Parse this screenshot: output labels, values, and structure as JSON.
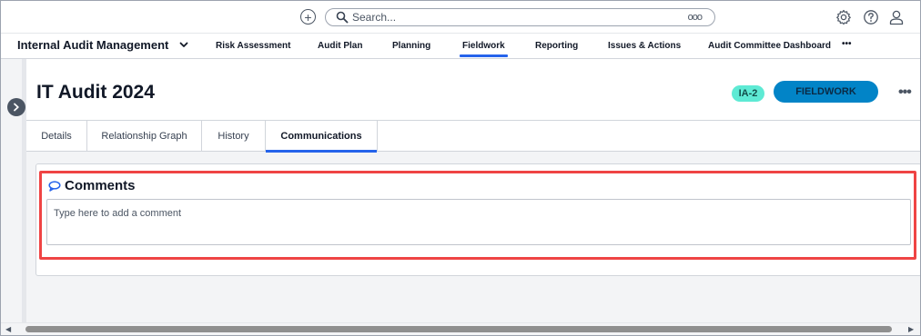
{
  "topbar": {
    "add_icon": "plus-circle-icon",
    "search_placeholder": "Search...",
    "more_label": "ooo",
    "icons": [
      "gear-icon",
      "help-icon",
      "user-icon"
    ]
  },
  "app": {
    "name": "Internal Audit Management"
  },
  "nav": {
    "items": [
      {
        "label": "Risk Assessment"
      },
      {
        "label": "Audit Plan"
      },
      {
        "label": "Planning"
      },
      {
        "label": "Fieldwork"
      },
      {
        "label": "Reporting"
      },
      {
        "label": "Issues & Actions"
      },
      {
        "label": "Audit Committee Dashboard"
      }
    ],
    "more_label": "•••",
    "active": "Fieldwork"
  },
  "record": {
    "title": "IT Audit 2024",
    "id": "IA-2",
    "status": "FIELDWORK",
    "more_label": "•••"
  },
  "tabs": [
    {
      "label": "Details"
    },
    {
      "label": "Relationship Graph"
    },
    {
      "label": "History"
    },
    {
      "label": "Communications"
    }
  ],
  "active_tab": "Communications",
  "comments": {
    "title": "Comments",
    "placeholder": "Type here to add a comment"
  },
  "colors": {
    "accent": "#2563eb",
    "status_button": "#0284c7",
    "id_badge": "#5eead4",
    "highlight": "#ef4444"
  }
}
